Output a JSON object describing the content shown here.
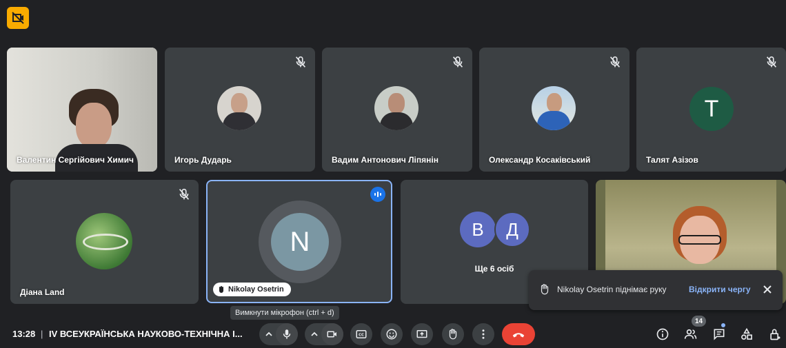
{
  "participants": [
    {
      "name": "Валентин Сергійович Химич"
    },
    {
      "name": "Игорь Дударь"
    },
    {
      "name": "Вадим Антонович Ліпянін"
    },
    {
      "name": "Олександр Косаківський"
    },
    {
      "name": "Талят Азізов",
      "initial": "T"
    },
    {
      "name": "Діана Land"
    },
    {
      "name": "Nikolay Osetrin",
      "initial": "N"
    },
    {
      "name": "Ще 6 осіб",
      "initials": [
        "B",
        "Д"
      ]
    },
    {
      "name": ""
    }
  ],
  "tooltip": "Вимкнути мікрофон (ctrl + d)",
  "notification": {
    "text": "Nikolay Osetrin піднімає руку",
    "action": "Відкрити чергу"
  },
  "footer": {
    "time": "13:28",
    "separator": "|",
    "meeting_title": "IV ВСЕУКРАЇНСЬКА НАУКОВО-ТЕХНІЧНА І...",
    "participant_count": "14"
  },
  "colors": {
    "background": "#202124",
    "tile": "#3c4043",
    "active_border": "#8ab4f8",
    "end_call": "#ea4335",
    "letter_t": "#1e5b44",
    "letter_n": "#7b97a3",
    "letter_b": "#5c6bc0"
  }
}
